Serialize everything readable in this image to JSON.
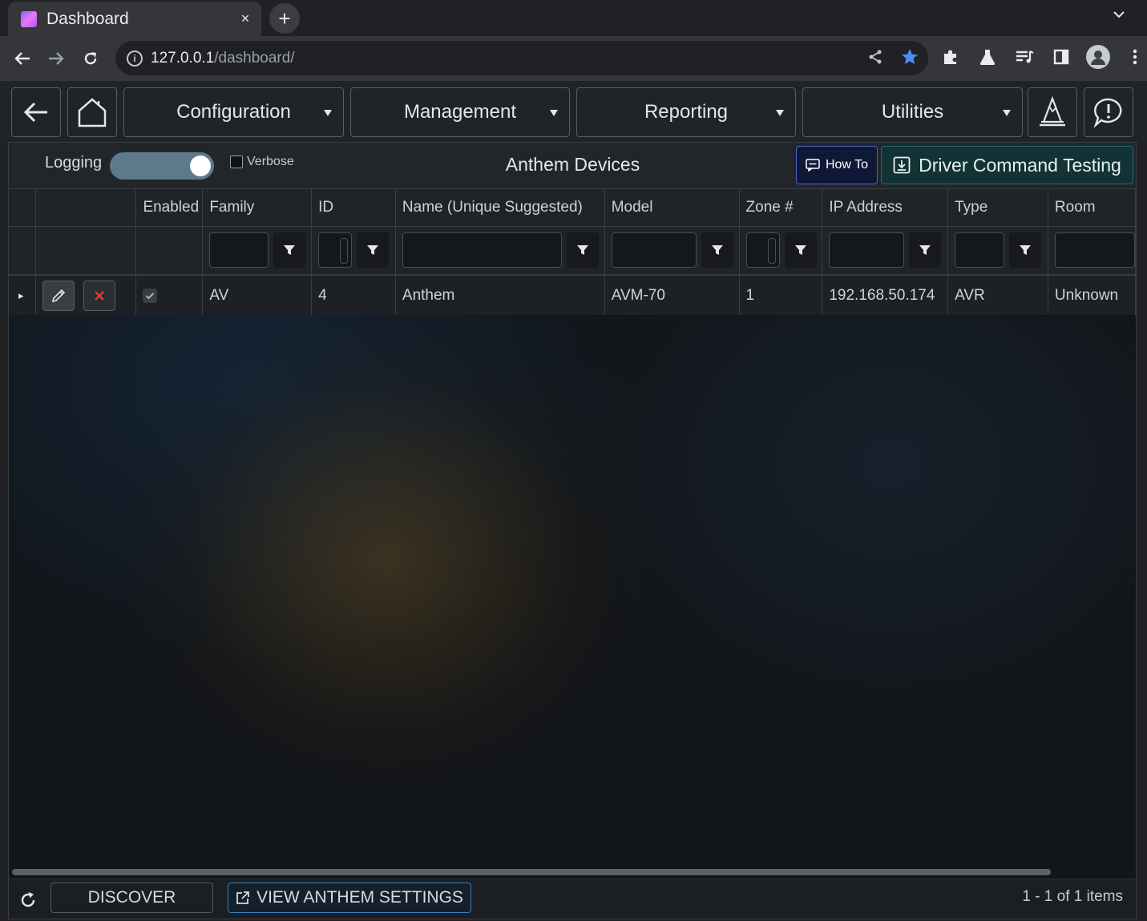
{
  "browser": {
    "tab_title": "Dashboard",
    "tab_close": "×",
    "new_tab": "+",
    "url_host": "127.0.0.1",
    "url_path": "/dashboard/"
  },
  "nav": {
    "menus": [
      "Configuration",
      "Management",
      "Reporting",
      "Utilities"
    ]
  },
  "toolbar": {
    "logging_label": "Logging",
    "logging_on": true,
    "verbose_label": "Verbose",
    "verbose_checked": false,
    "title": "Anthem Devices",
    "howto_label": "How To",
    "driver_testing_label": "Driver Command Testing"
  },
  "grid": {
    "columns": [
      "",
      "",
      "Enabled",
      "Family",
      "ID",
      "Name (Unique Suggested)",
      "Model",
      "Zone #",
      "IP Address",
      "Type",
      "Room"
    ],
    "rows": [
      {
        "expand": "▸",
        "enabled": true,
        "family": "AV",
        "id": "4",
        "name": "Anthem",
        "model": "AVM-70",
        "zone": "1",
        "ip": "192.168.50.174",
        "type": "AVR",
        "room": "Unknown"
      }
    ]
  },
  "footer": {
    "discover_label": "DISCOVER",
    "view_settings_label": "VIEW ANTHEM SETTINGS",
    "pager": "1 - 1 of 1 items"
  },
  "colors": {
    "howto_bg": "#101838",
    "driver_testing_bg": "#123236",
    "delete_x": "#e53935",
    "bookmark_star": "#4c8df6"
  }
}
